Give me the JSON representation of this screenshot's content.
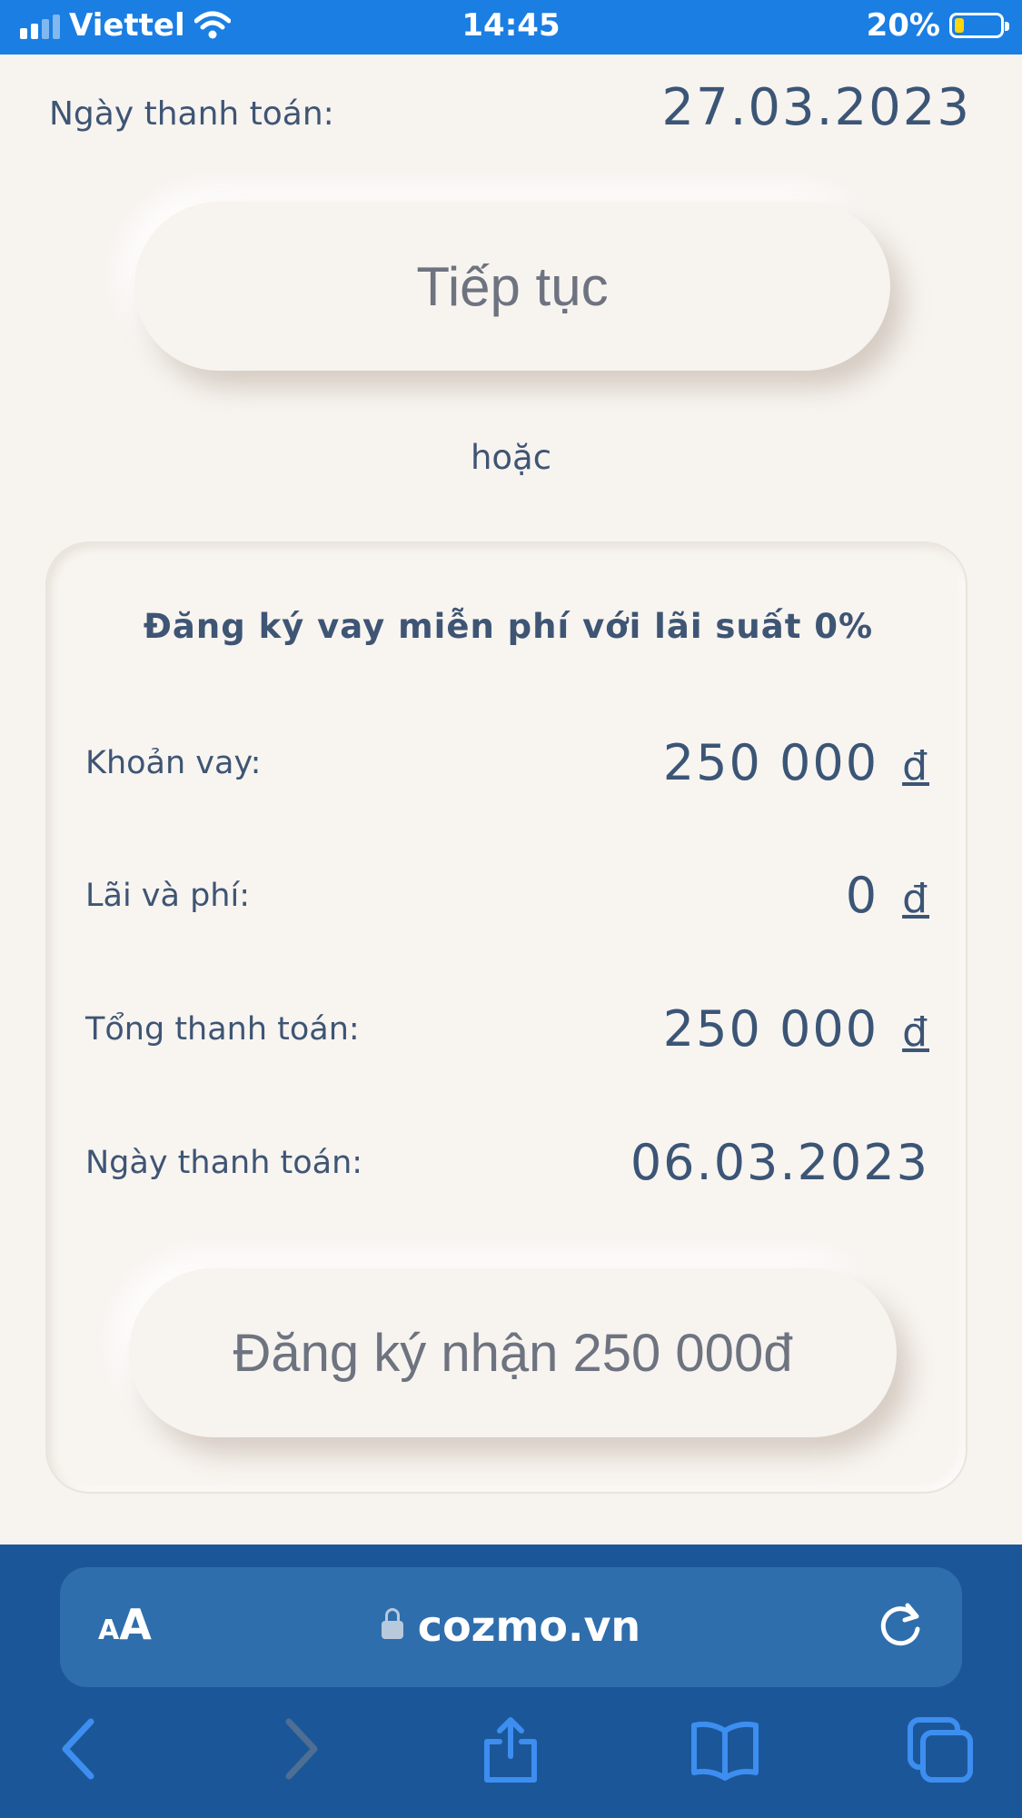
{
  "status_bar": {
    "carrier": "Viettel",
    "time": "14:45",
    "battery": "20%"
  },
  "payment": {
    "date_label": "Ngày thanh toán:",
    "date_value": "27.03.2023",
    "continue_label": "Tiếp tục"
  },
  "or_text": "hoặc",
  "loan_card": {
    "title": "Đăng ký vay miễn phí với lãi suất 0%",
    "rows": [
      {
        "label": "Khoản vay:",
        "value": "250 000",
        "currency": "đ"
      },
      {
        "label": "Lãi và phí:",
        "value": "0",
        "currency": "đ"
      },
      {
        "label": "Tổng thanh toán:",
        "value": "250 000",
        "currency": "đ"
      },
      {
        "label": "Ngày thanh toán:",
        "value": "06.03.2023"
      }
    ],
    "register_label": "Đăng ký nhận 250 000đ"
  },
  "browser": {
    "aa_small": "A",
    "aa_big": "A",
    "url": "cozmo.vn",
    "icons": [
      "aa-text-size-icon",
      "lock-icon",
      "reload-icon",
      "back-icon",
      "forward-icon",
      "share-icon",
      "bookmarks-icon",
      "tabs-icon"
    ]
  },
  "colors": {
    "status_bar": "#1a7ee3",
    "page_background": "#f7f3ef",
    "text": "#3e5574",
    "browser_background": "#1b5798",
    "url_bar": "#2f6eac",
    "toolbar_icon": "#3d8ef0"
  }
}
